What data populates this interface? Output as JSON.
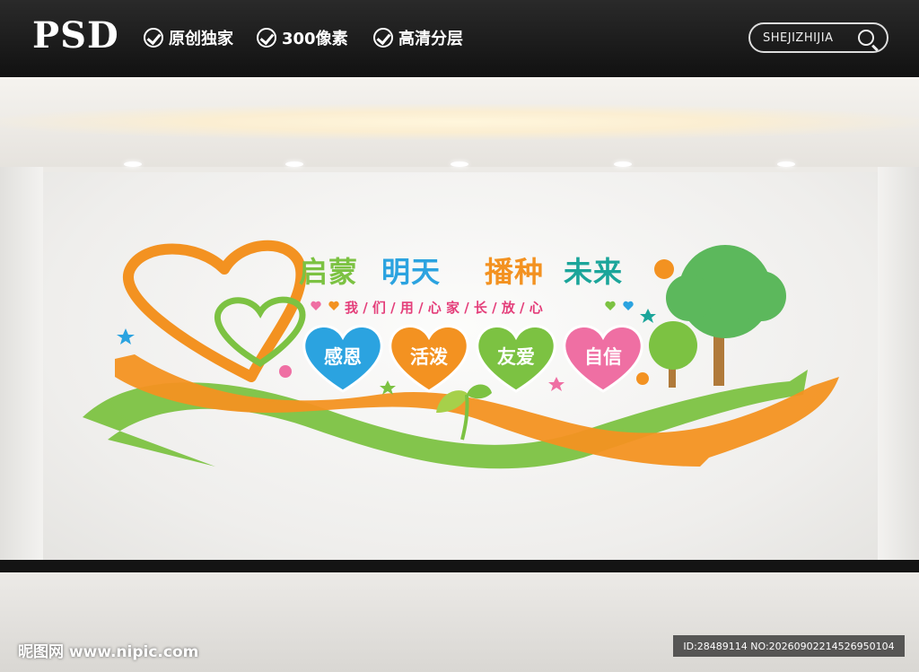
{
  "header": {
    "logo": "PSD",
    "badges": [
      "原创独家",
      "300像素",
      "高清分层"
    ],
    "search_label": "SHEJIZHIJIA"
  },
  "wall": {
    "title_part1": "启蒙",
    "title_part2": "明天",
    "title_part3": "播种",
    "title_part4": "未来",
    "subtitle": "我 / 们 / 用 / 心   家 / 长 / 放 / 心",
    "hearts": [
      {
        "label": "感恩",
        "color": "#2ba3e0"
      },
      {
        "label": "活泼",
        "color": "#f39221"
      },
      {
        "label": "友爱",
        "color": "#7cc242"
      },
      {
        "label": "自信",
        "color": "#ef6fa3"
      }
    ]
  },
  "footer": {
    "watermark": "昵图网 www.nipic.com",
    "id_text": "ID:28489114 NO:20260902214526950104"
  },
  "colors": {
    "orange": "#f39221",
    "green": "#7cc242",
    "blue": "#2ba3e0",
    "teal": "#1ba59a",
    "pink": "#e43e7a"
  }
}
